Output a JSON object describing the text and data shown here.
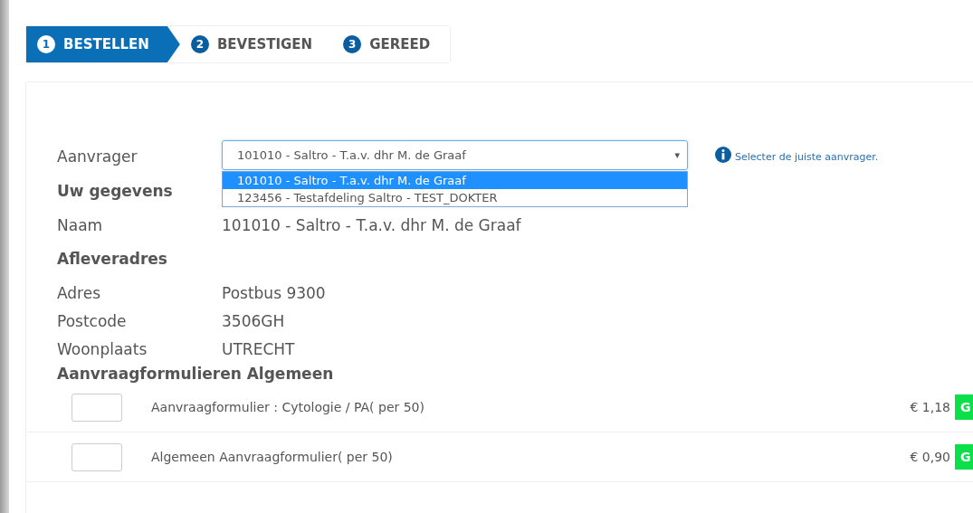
{
  "steps": [
    {
      "number": "1",
      "label": "BESTELLEN",
      "selected": true
    },
    {
      "number": "2",
      "label": "BEVESTIGEN",
      "selected": false
    },
    {
      "number": "3",
      "label": "GEREED",
      "selected": false
    }
  ],
  "requester": {
    "label": "Aanvrager",
    "value": "101010 - Saltro - T.a.v. dhr M. de Graaf",
    "caret": "▾",
    "hint": "Selecter de juiste aanvrager.",
    "options": [
      {
        "label": "101010 - Saltro - T.a.v. dhr M. de Graaf",
        "selected": true
      },
      {
        "label": "123456 - Testafdeling Saltro - TEST_DOKTER",
        "selected": false
      }
    ]
  },
  "details": {
    "title": "Uw gegevens",
    "rows": [
      {
        "label": "Naam",
        "value": "101010 - Saltro - T.a.v. dhr M. de Graaf"
      }
    ]
  },
  "address": {
    "title": "Afleveradres",
    "rows": [
      {
        "label": "Adres",
        "value": "Postbus 9300"
      },
      {
        "label": "Postcode",
        "value": "3506GH"
      },
      {
        "label": "Woonplaats",
        "value": "UTRECHT"
      }
    ]
  },
  "forms": {
    "title": "Aanvraagformulieren Algemeen",
    "items": [
      {
        "name": "Aanvraagformulier : Cytologie / PA( per 50)",
        "price": "€ 1,18",
        "button": "G"
      },
      {
        "name": "Algemeen Aanvraagformulier( per 50)",
        "price": "€ 0,90",
        "button": "G"
      }
    ]
  }
}
